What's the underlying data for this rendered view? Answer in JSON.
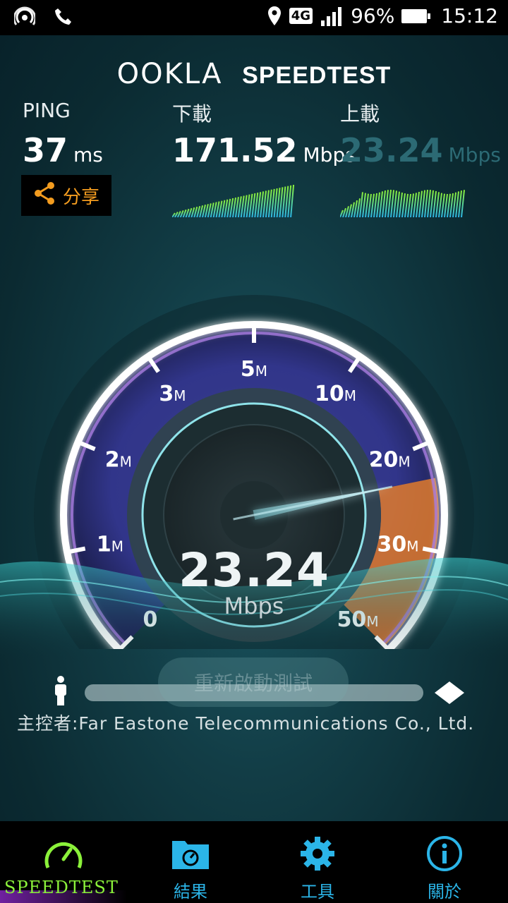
{
  "status_bar": {
    "network": "4G",
    "battery": "96%",
    "time": "15:12"
  },
  "header": {
    "brand": "OOKLA",
    "product": "SPEEDTEST"
  },
  "metrics": {
    "ping": {
      "label": "PING",
      "value": "37",
      "unit": "ms"
    },
    "download": {
      "label": "下載",
      "value": "171.52",
      "unit": "Mbps"
    },
    "upload": {
      "label": "上載",
      "value": "23.24",
      "unit": "Mbps"
    }
  },
  "share": {
    "label": "分享"
  },
  "gauge": {
    "ticks": [
      {
        "num": "0",
        "unit": ""
      },
      {
        "num": "1",
        "unit": "M"
      },
      {
        "num": "2",
        "unit": "M"
      },
      {
        "num": "3",
        "unit": "M"
      },
      {
        "num": "5",
        "unit": "M"
      },
      {
        "num": "10",
        "unit": "M"
      },
      {
        "num": "20",
        "unit": "M"
      },
      {
        "num": "30",
        "unit": "M"
      },
      {
        "num": "50",
        "unit": "M"
      }
    ],
    "current_value": "23.24",
    "current_unit": "Mbps"
  },
  "restart_button": {
    "label": "重新啟動測試"
  },
  "host": {
    "text": "主控者:Far Eastone Telecommunications Co., Ltd."
  },
  "nav": {
    "items": [
      {
        "label": "SPEEDTEST"
      },
      {
        "label": "結果"
      },
      {
        "label": "工具"
      },
      {
        "label": "關於"
      }
    ]
  },
  "colors": {
    "accent_green": "#8bf13a",
    "accent_blue": "#2bb5e8",
    "share_orange": "#f39c1f",
    "gauge_highlight": "#e07a2c"
  }
}
